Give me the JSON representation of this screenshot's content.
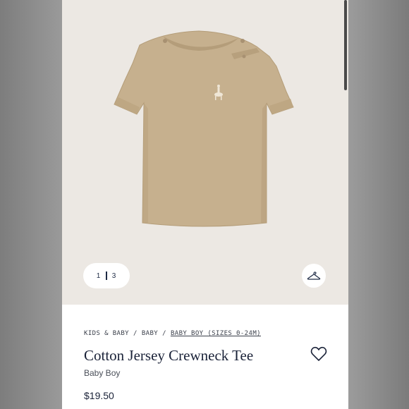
{
  "gallery": {
    "pager": {
      "current": "1",
      "total": "3"
    },
    "hanger_icon": "hanger-icon"
  },
  "product": {
    "breadcrumb": [
      "KIDS & BABY",
      "BABY",
      "BABY BOY (SIZES 0-24M)"
    ],
    "title": "Cotton Jersey Crewneck Tee",
    "subtitle": "Baby Boy",
    "price": "$19.50",
    "favorite_icon": "heart-icon"
  },
  "colors": {
    "gallery_bg": "#ece8e3",
    "shirt": "#c6b08e",
    "text_navy": "#1a2238"
  }
}
